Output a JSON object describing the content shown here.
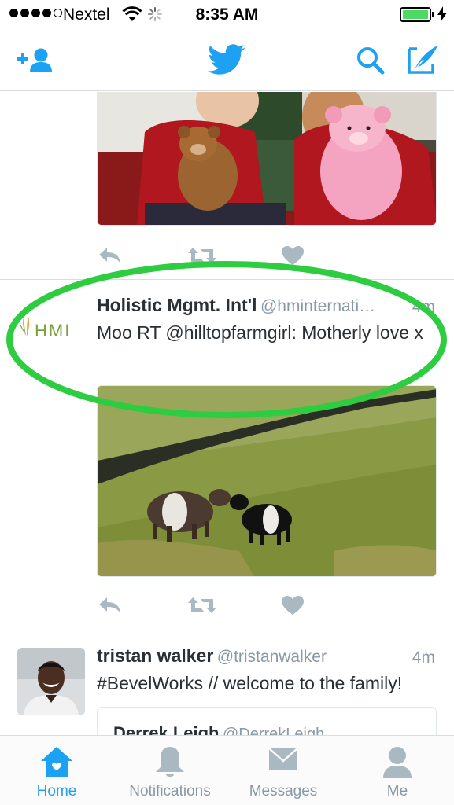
{
  "status_bar": {
    "carrier": "Nextel",
    "time": "8:35 AM",
    "battery_level": 1.0
  },
  "nav_bar": {
    "icons": [
      "add-user-icon",
      "twitter-bird-icon",
      "search-icon",
      "compose-icon"
    ]
  },
  "colors": {
    "brand_blue": "#1da1f2",
    "muted": "#8899a6",
    "text": "#292f33",
    "highlight_green": "#2ecc40"
  },
  "feed": {
    "tweets": [
      {
        "has_photo": true,
        "photo_subject": "children-with-teddy-bears"
      },
      {
        "name": "Holistic Mgmt. Int'l",
        "handle": "@hminternati…",
        "time": "4m",
        "text": "Moo RT @hilltopfarmgirl: Motherly love x",
        "avatar_text": "HMI",
        "has_photo": true
      },
      {
        "name": "tristan walker",
        "handle": "@tristanwalker",
        "time": "4m",
        "text": "#BevelWorks // welcome to the family!",
        "quoted": {
          "name": "Derrek Leigh",
          "handle": "@DerrekLeigh"
        }
      }
    ]
  },
  "tab_bar": {
    "tabs": [
      {
        "label": "Home",
        "icon": "home-icon",
        "active": true
      },
      {
        "label": "Notifications",
        "icon": "bell-icon",
        "active": false
      },
      {
        "label": "Messages",
        "icon": "envelope-icon",
        "active": false
      },
      {
        "label": "Me",
        "icon": "person-icon",
        "active": false
      }
    ]
  }
}
